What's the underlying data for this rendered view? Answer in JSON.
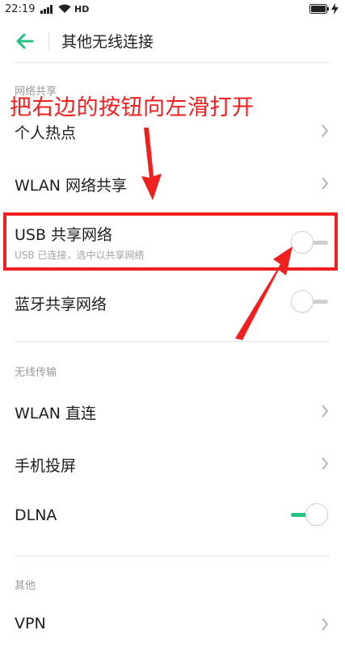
{
  "status_bar": {
    "time": "22:19",
    "network_label": "HD",
    "icons": [
      "signal-icon",
      "wifi-icon",
      "battery-icon",
      "charging-icon"
    ]
  },
  "header": {
    "title": "其他无线连接",
    "back_icon": "back-arrow-icon"
  },
  "sections": {
    "network_sharing": {
      "header": "网络共享",
      "items": [
        {
          "label": "个人热点",
          "control": "chevron"
        },
        {
          "label": "WLAN 网络共享",
          "control": "chevron"
        },
        {
          "label": "USB 共享网络",
          "sublabel": "USB 已连接，选中以共享网络",
          "control": "toggle",
          "state": "off"
        },
        {
          "label": "蓝牙共享网络",
          "control": "toggle",
          "state": "off"
        }
      ]
    },
    "wireless_transfer": {
      "header": "无线传输",
      "items": [
        {
          "label": "WLAN 直连",
          "control": "chevron"
        },
        {
          "label": "手机投屏",
          "control": "chevron"
        },
        {
          "label": "DLNA",
          "control": "toggle",
          "state": "on"
        }
      ]
    },
    "other": {
      "header": "其他",
      "items": [
        {
          "label": "VPN",
          "control": "chevron"
        }
      ]
    }
  },
  "annotation": {
    "text": "把右边的按钮向左滑打开",
    "color": "#ee2020"
  },
  "colors": {
    "accent": "#26c281",
    "annotation": "#ee2020",
    "section_header": "#9a9a9a"
  }
}
